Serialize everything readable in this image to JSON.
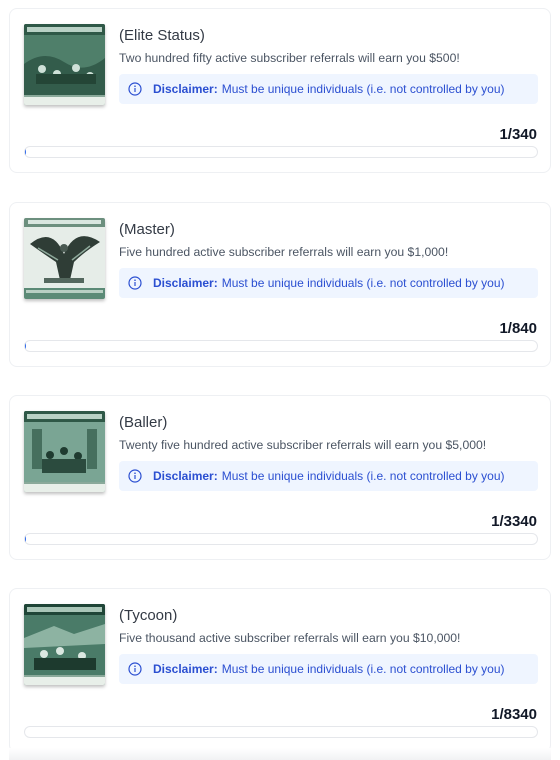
{
  "disclaimer_label": "Disclaimer:",
  "disclaimer_text": "Must be unique individuals (i.e. not controlled by you)",
  "tiers": [
    {
      "title": "(Elite Status)",
      "description": "Two hundred fifty active subscriber referrals will earn you $500!",
      "progress_text": "1/340",
      "progress": 0.0029,
      "image": "note-assembly-scene"
    },
    {
      "title": "(Master)",
      "description": "Five hundred active subscriber referrals will earn you $1,000!",
      "progress_text": "1/840",
      "progress": 0.0012,
      "image": "note-eagle"
    },
    {
      "title": "(Baller)",
      "description": "Twenty five hundred active subscriber referrals will earn you $5,000!",
      "progress_text": "1/3340",
      "progress": 0.0003,
      "image": "note-assembly-scene"
    },
    {
      "title": "(Tycoon)",
      "description": "Five thousand active subscriber referrals will earn you $10,000!",
      "progress_text": "1/8340",
      "progress": 0.0001,
      "image": "note-landing-scene"
    }
  ],
  "colors": {
    "accent": "#2563eb",
    "disclaimer_bg": "#eff5ff",
    "disclaimer_text": "#2b4fd1",
    "note_green": "#3f6b58"
  }
}
